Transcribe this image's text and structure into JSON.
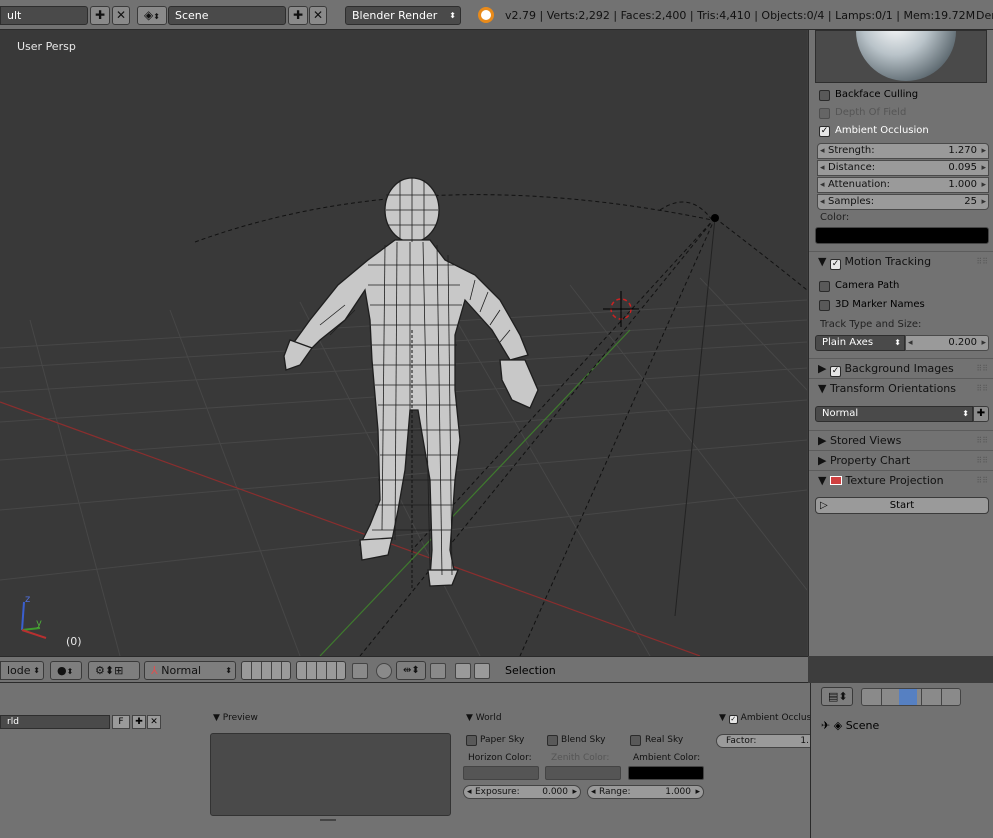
{
  "topbar": {
    "layout_name": "ult",
    "scene_name": "Scene",
    "render_engine": "Blender Render",
    "stats": "v2.79 | Verts:2,292 | Faces:2,400 | Tris:4,410 | Objects:0/4 | Lamps:0/1 | Mem:19.72M",
    "extra": "Der"
  },
  "viewport": {
    "view_name": "User Persp",
    "frame": "(0)",
    "axis_z": "z",
    "axis_y": "y"
  },
  "npanel": {
    "backface_culling": "Backface Culling",
    "depth_of_field": "Depth Of Field",
    "ambient_occlusion": "Ambient Occlusion",
    "strength_label": "Strength:",
    "strength_value": "1.270",
    "distance_label": "Distance:",
    "distance_value": "0.095",
    "attenuation_label": "Attenuation:",
    "attenuation_value": "1.000",
    "samples_label": "Samples:",
    "samples_value": "25",
    "color_label": "Color:",
    "motion_tracking": "Motion Tracking",
    "camera_path": "Camera Path",
    "marker_names": "3D Marker Names",
    "track_type_label": "Track Type and Size:",
    "track_type_value": "Plain Axes",
    "track_size_value": "0.200",
    "background_images": "Background Images",
    "transform_orientations": "Transform Orientations",
    "orientation_value": "Normal",
    "stored_views": "Stored Views",
    "property_chart": "Property Chart",
    "texture_projection": "Texture Projection",
    "start_button": "Start"
  },
  "view_header": {
    "mode": "lode",
    "orientation": "Normal",
    "selection": "Selection"
  },
  "properties": {
    "world_name": "rld",
    "fake_user": "F",
    "preview": "Preview",
    "world": "World",
    "paper_sky": "Paper Sky",
    "blend_sky": "Blend Sky",
    "real_sky": "Real Sky",
    "horizon_color": "Horizon Color:",
    "zenith_color": "Zenith Color:",
    "ambient_color": "Ambient Color:",
    "exposure_label": "Exposure:",
    "exposure_value": "0.000",
    "range_label": "Range:",
    "range_value": "1.000",
    "ao_panel": "Ambient Occlusio",
    "factor_label": "Factor:",
    "factor_value": "1."
  },
  "outliner": {
    "scene": "Scene"
  }
}
